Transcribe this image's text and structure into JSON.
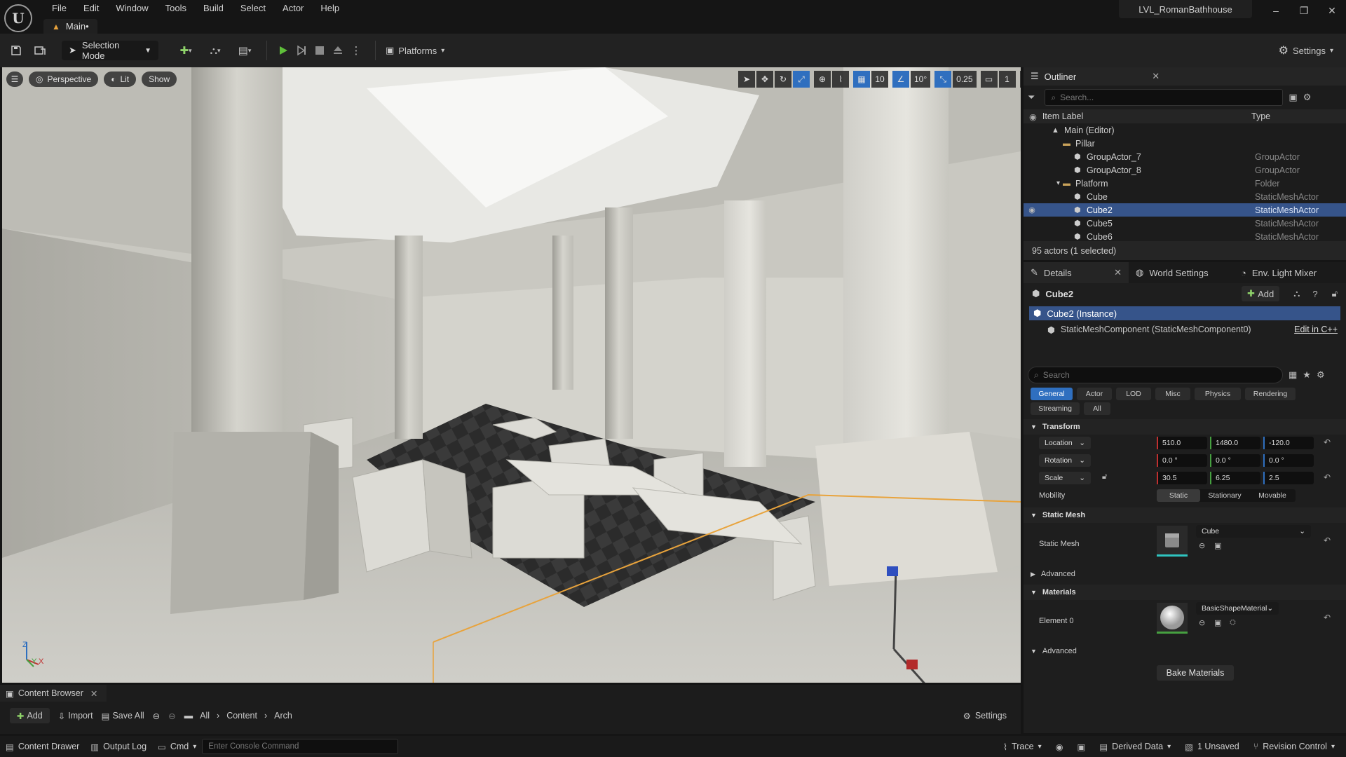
{
  "app": {
    "logo": "U",
    "project": "LVL_RomanBathhouse",
    "menu": [
      "File",
      "Edit",
      "Window",
      "Tools",
      "Build",
      "Select",
      "Actor",
      "Help"
    ],
    "level_tab": "Main•",
    "window_controls": [
      "–",
      "❐",
      "✕"
    ]
  },
  "toolbar": {
    "selection_mode": "Selection Mode",
    "platforms": "Platforms",
    "settings": "Settings"
  },
  "viewport": {
    "perspective": "Perspective",
    "lit": "Lit",
    "show": "Show",
    "grid_snap": "10",
    "rot_snap": "10°",
    "scale_snap": "0.25",
    "camera_speed": "1",
    "axis": {
      "z": "Z",
      "y": "Y",
      "x": "X"
    }
  },
  "outliner": {
    "title": "Outliner",
    "search_placeholder": "Search...",
    "col_label": "Item Label",
    "col_type": "Type",
    "rows": [
      {
        "label": "Main (Editor)",
        "type": "",
        "indent": 1
      },
      {
        "label": "Pillar",
        "type": "",
        "indent": 2
      },
      {
        "label": "GroupActor_7",
        "type": "GroupActor",
        "indent": 3
      },
      {
        "label": "GroupActor_8",
        "type": "GroupActor",
        "indent": 3
      },
      {
        "label": "Platform",
        "type": "Folder",
        "indent": 2
      },
      {
        "label": "Cube",
        "type": "StaticMeshActor",
        "indent": 3
      },
      {
        "label": "Cube2",
        "type": "StaticMeshActor",
        "indent": 3
      },
      {
        "label": "Cube5",
        "type": "StaticMeshActor",
        "indent": 3
      },
      {
        "label": "Cube6",
        "type": "StaticMeshActor",
        "indent": 3
      }
    ],
    "selected_row": 6,
    "status": "95 actors (1 selected)"
  },
  "details": {
    "tabs": [
      "Details",
      "World Settings",
      "Env. Light Mixer"
    ],
    "object": "Cube2",
    "add": "Add",
    "instance": "Cube2 (Instance)",
    "component": "StaticMeshComponent (StaticMeshComponent0)",
    "edit_cpp": "Edit in C++",
    "search_placeholder": "Search",
    "filters_row1": [
      "General",
      "Actor",
      "LOD",
      "Misc",
      "Physics",
      "Rendering"
    ],
    "filters_row2": [
      "Streaming",
      "All"
    ],
    "transform": {
      "title": "Transform",
      "location": {
        "label": "Location",
        "x": "510.0",
        "y": "1480.0",
        "z": "-120.0"
      },
      "rotation": {
        "label": "Rotation",
        "x": "0.0 °",
        "y": "0.0 °",
        "z": "0.0 °"
      },
      "scale": {
        "label": "Scale",
        "x": "30.5",
        "y": "6.25",
        "z": "2.5"
      },
      "mobility": {
        "label": "Mobility",
        "options": [
          "Static",
          "Stationary",
          "Movable"
        ],
        "selected": "Static"
      }
    },
    "static_mesh": {
      "title": "Static Mesh",
      "label": "Static Mesh",
      "value": "Cube"
    },
    "advanced": "Advanced",
    "materials": {
      "title": "Materials",
      "element": "Element 0",
      "value": "BasicShapeMaterial"
    },
    "bake": "Bake Materials"
  },
  "content_browser": {
    "title": "Content Browser",
    "add": "Add",
    "import": "Import",
    "save_all": "Save All",
    "path": [
      "All",
      "Content",
      "Arch"
    ],
    "settings": "Settings"
  },
  "statusbar": {
    "content_drawer": "Content Drawer",
    "output_log": "Output Log",
    "cmd": "Cmd",
    "console_placeholder": "Enter Console Command",
    "trace": "Trace",
    "derived_data": "Derived Data",
    "unsaved": "1 Unsaved",
    "revision": "Revision Control"
  },
  "colors": {
    "accent": "#2f6fbf",
    "selection": "#36548a",
    "warning": "#e8a33c",
    "play": "#5fbf3a"
  }
}
